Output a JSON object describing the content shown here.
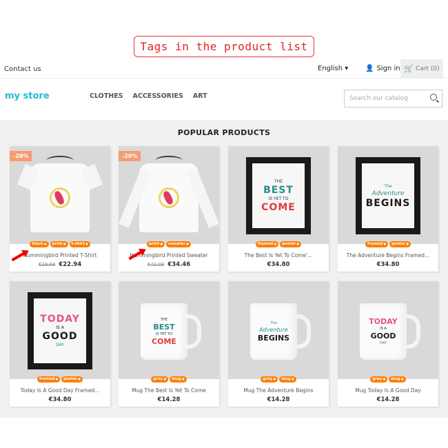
{
  "banner": {
    "text": "Tags in the product list"
  },
  "topbar": {
    "contact": "Contact us",
    "language": "English",
    "signin": "Sign in",
    "cart": "Cart (0)"
  },
  "header": {
    "logo": "my store",
    "nav": [
      "CLOTHES",
      "ACCESSORIES",
      "ART"
    ],
    "search_placeholder": "Search our catalog"
  },
  "section_title": "POPULAR PRODUCTS",
  "products": [
    {
      "name": "Hummingbird Printed T-Shirt",
      "old_price": "€28.68",
      "price": "€22.94",
      "discount": "-20%",
      "tags": [
        "black",
        "print",
        "t-shirt"
      ]
    },
    {
      "name": "Hummingbird Printed Sweater",
      "old_price": "€43.08",
      "price": "€34.46",
      "discount": "-20%",
      "tags": [
        "print",
        "sweater"
      ]
    },
    {
      "name": "The Best Is Yet To Come'...",
      "price": "€34.80",
      "tags": [
        "framed",
        "poster"
      ]
    },
    {
      "name": "The Adventure Begins Framed...",
      "price": "€34.80",
      "tags": [
        "framed",
        "poster"
      ]
    },
    {
      "name": "Today Is A Good Day Framed...",
      "price": "€34.80",
      "tags": [
        "framed",
        "poster"
      ]
    },
    {
      "name": "Mug The Best Is Yet To Come",
      "price": "€14.28",
      "tags": [
        "grey",
        "mug"
      ]
    },
    {
      "name": "Mug The Adventure Begins",
      "price": "€14.28",
      "tags": [
        "grey",
        "mug"
      ]
    },
    {
      "name": "Mug Today Is A Good Day",
      "price": "€14.28",
      "tags": [
        "grey",
        "mug"
      ]
    }
  ],
  "art": {
    "best": [
      "THE",
      "BEST",
      "IS YET TO",
      "COME"
    ],
    "adventure": [
      "The",
      "Adventure",
      "BEGINS"
    ],
    "today": [
      "TODAY",
      "IS A",
      "GOOD",
      "DAY"
    ]
  },
  "colors": {
    "tag": "#ff7f00",
    "discount": "#f39d72",
    "accent": "#2fb5d2",
    "banner": "#e32222"
  }
}
